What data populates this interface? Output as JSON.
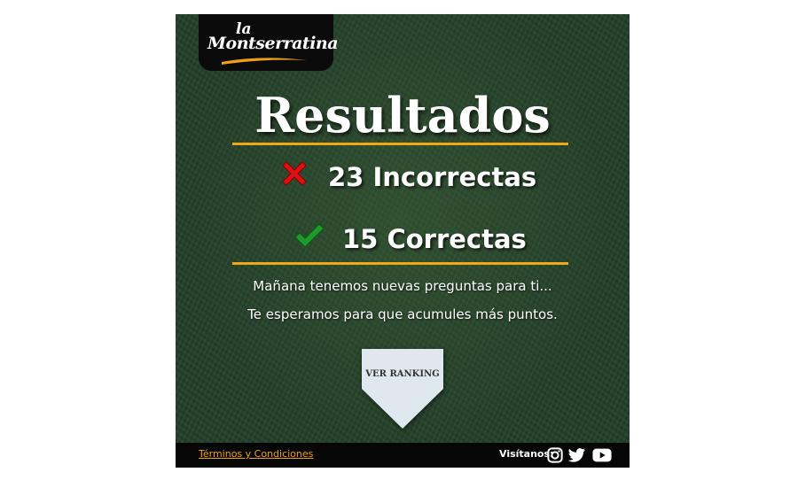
{
  "logo": {
    "line1": "la",
    "line2": "Montserratina"
  },
  "title": "Resultados",
  "results": {
    "incorrect": {
      "icon": "cross-icon",
      "text": "23 Incorrectas",
      "color": "#e01010"
    },
    "correct": {
      "icon": "check-icon",
      "text": "15 Correctas",
      "color": "#1f9a2a"
    }
  },
  "messages": {
    "line1": "Mañana tenemos nuevas preguntas para ti...",
    "line2": "Te esperamos para que acumules más puntos."
  },
  "ranking_button": {
    "label": "VER RANKING"
  },
  "footer": {
    "terms_link": "Términos y Condiciones",
    "visit_label": "Visítanos:",
    "social": [
      "instagram-icon",
      "twitter-icon",
      "youtube-icon"
    ]
  },
  "colors": {
    "accent": "#f0a818",
    "background": "#24402a",
    "footer": "#060606"
  }
}
